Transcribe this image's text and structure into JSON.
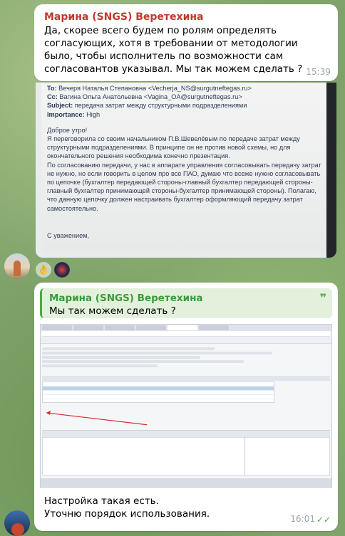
{
  "message1": {
    "sender": "Марина (SNGS) Веретехина",
    "text": "Да, скорее всего будем по ролям определять согласующих,  хотя в требовании от методологии было, чтобы исполнитель по возможности сам согласовантов указывал. Мы так можем сделать ?",
    "time": "15:39"
  },
  "email_photo": {
    "to_label": "To:",
    "to_value": "Вечеря Наталья Степановна <Vecherja_NS@surgutneftegas.ru>",
    "cc_label": "Cc:",
    "cc_value": "Вагина Ольга Анатольевна <Vagina_OA@surgutneftegas.ru>",
    "subject_label": "Subject:",
    "subject_value": "передача затрат между структурными подразделениями",
    "importance_label": "Importance:",
    "importance_value": "High",
    "greeting": "Доброе утро!",
    "body": "Я переговорила со своим начальником П.В.Шевелёвым по передаче затрат между структурными подразделениями. В принципе он не против новой схемы, но для окончательного решения необходима конечно презентация.\nПо согласованию передачи, у нас в аппарате управления согласовывать передачу затрат не нужно, но если говорить в целом про все ПАО, думаю что всеже нужно согласовывать по цепочке (бухгалтер передающей стороны-главный бухгалтер передающей стороны-главный бухгалтер принимающей стороны-бухгалтер принимающей стороны). Полагаю, что данную цепочку должен настраивать бухгалтер оформляющий передачу затрат самостоятельно.",
    "signoff": "С уважением,"
  },
  "reactions": [
    {
      "icon": "👌"
    }
  ],
  "message2": {
    "reply_sender": "Марина (SNGS) Веретехина",
    "reply_text": "Мы так можем сделать ?",
    "text_line1": "Настройка такая есть.",
    "text_line2": "Уточню порядок использования.",
    "time": "16:01",
    "check_icon": "✓✓"
  },
  "colors": {
    "sender_red": "#c0392b",
    "reply_green": "#3a9a3a",
    "chat_bg": "#7fa36a"
  }
}
